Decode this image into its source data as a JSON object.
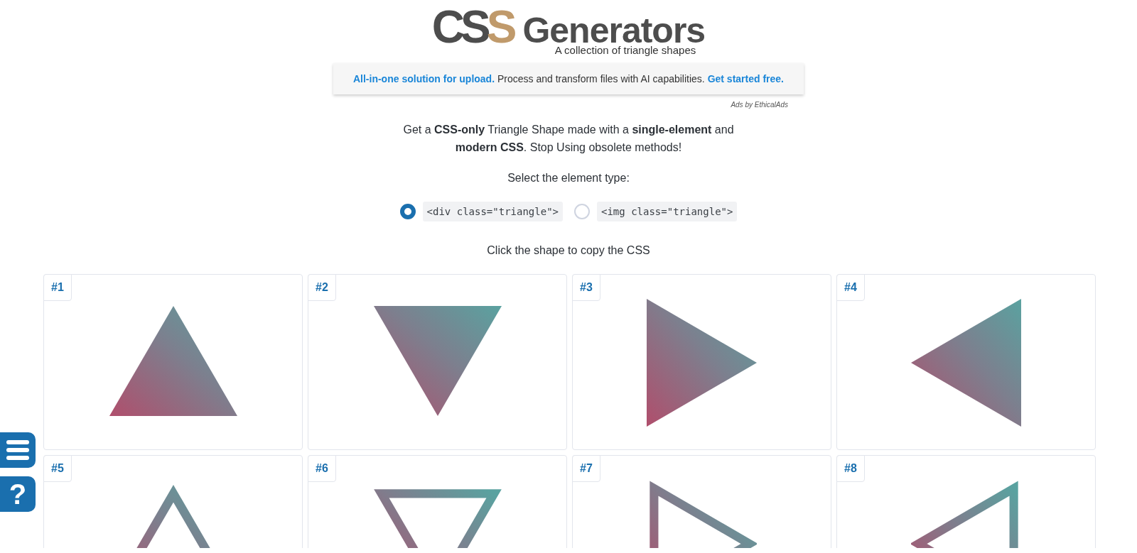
{
  "logo": {
    "mark": "CSS",
    "name": "Generators",
    "tagline": "A collection of triangle shapes"
  },
  "ad": {
    "lead": "All-in-one solution for upload.",
    "body": "Process and transform files with AI capabilities.",
    "cta": "Get started free.",
    "credit": "Ads by EthicalAds"
  },
  "intro": "Get a **CSS-only** Triangle Shape made with a **single-element** and **modern CSS**. Stop Using obsolete methods!",
  "element_type": {
    "prompt": "Select the element type:",
    "options": [
      {
        "label": "<div class=\"triangle\">",
        "selected": true
      },
      {
        "label": "<img class=\"triangle\">",
        "selected": false
      }
    ]
  },
  "hint": "Click the shape to copy the CSS",
  "cards": [
    {
      "label": "#1",
      "kind": "up",
      "hollow": false
    },
    {
      "label": "#2",
      "kind": "down",
      "hollow": false
    },
    {
      "label": "#3",
      "kind": "right",
      "hollow": false
    },
    {
      "label": "#4",
      "kind": "left",
      "hollow": false
    },
    {
      "label": "#5",
      "kind": "up",
      "hollow": true
    },
    {
      "label": "#6",
      "kind": "down",
      "hollow": true
    },
    {
      "label": "#7",
      "kind": "right",
      "hollow": true
    },
    {
      "label": "#8",
      "kind": "left",
      "hollow": true
    }
  ],
  "side_buttons": [
    {
      "kind": "menu"
    },
    {
      "kind": "help",
      "text": "?"
    }
  ]
}
